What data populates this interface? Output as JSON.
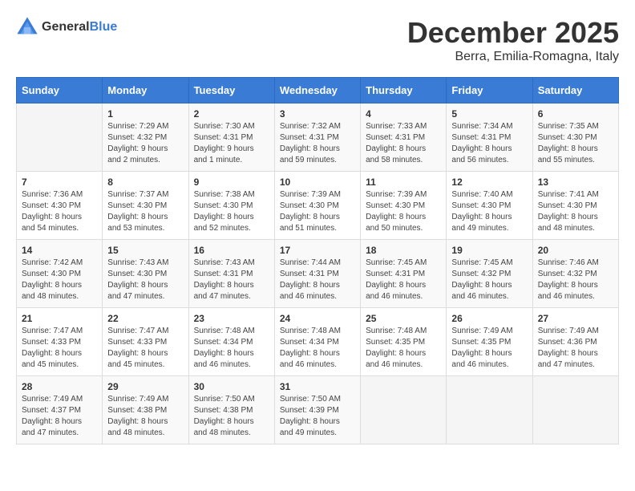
{
  "logo": {
    "text_general": "General",
    "text_blue": "Blue"
  },
  "title": "December 2025",
  "location": "Berra, Emilia-Romagna, Italy",
  "weekdays": [
    "Sunday",
    "Monday",
    "Tuesday",
    "Wednesday",
    "Thursday",
    "Friday",
    "Saturday"
  ],
  "rows": [
    [
      {
        "day": "",
        "lines": []
      },
      {
        "day": "1",
        "lines": [
          "Sunrise: 7:29 AM",
          "Sunset: 4:32 PM",
          "Daylight: 9 hours",
          "and 2 minutes."
        ]
      },
      {
        "day": "2",
        "lines": [
          "Sunrise: 7:30 AM",
          "Sunset: 4:31 PM",
          "Daylight: 9 hours",
          "and 1 minute."
        ]
      },
      {
        "day": "3",
        "lines": [
          "Sunrise: 7:32 AM",
          "Sunset: 4:31 PM",
          "Daylight: 8 hours",
          "and 59 minutes."
        ]
      },
      {
        "day": "4",
        "lines": [
          "Sunrise: 7:33 AM",
          "Sunset: 4:31 PM",
          "Daylight: 8 hours",
          "and 58 minutes."
        ]
      },
      {
        "day": "5",
        "lines": [
          "Sunrise: 7:34 AM",
          "Sunset: 4:31 PM",
          "Daylight: 8 hours",
          "and 56 minutes."
        ]
      },
      {
        "day": "6",
        "lines": [
          "Sunrise: 7:35 AM",
          "Sunset: 4:30 PM",
          "Daylight: 8 hours",
          "and 55 minutes."
        ]
      }
    ],
    [
      {
        "day": "7",
        "lines": [
          "Sunrise: 7:36 AM",
          "Sunset: 4:30 PM",
          "Daylight: 8 hours",
          "and 54 minutes."
        ]
      },
      {
        "day": "8",
        "lines": [
          "Sunrise: 7:37 AM",
          "Sunset: 4:30 PM",
          "Daylight: 8 hours",
          "and 53 minutes."
        ]
      },
      {
        "day": "9",
        "lines": [
          "Sunrise: 7:38 AM",
          "Sunset: 4:30 PM",
          "Daylight: 8 hours",
          "and 52 minutes."
        ]
      },
      {
        "day": "10",
        "lines": [
          "Sunrise: 7:39 AM",
          "Sunset: 4:30 PM",
          "Daylight: 8 hours",
          "and 51 minutes."
        ]
      },
      {
        "day": "11",
        "lines": [
          "Sunrise: 7:39 AM",
          "Sunset: 4:30 PM",
          "Daylight: 8 hours",
          "and 50 minutes."
        ]
      },
      {
        "day": "12",
        "lines": [
          "Sunrise: 7:40 AM",
          "Sunset: 4:30 PM",
          "Daylight: 8 hours",
          "and 49 minutes."
        ]
      },
      {
        "day": "13",
        "lines": [
          "Sunrise: 7:41 AM",
          "Sunset: 4:30 PM",
          "Daylight: 8 hours",
          "and 48 minutes."
        ]
      }
    ],
    [
      {
        "day": "14",
        "lines": [
          "Sunrise: 7:42 AM",
          "Sunset: 4:30 PM",
          "Daylight: 8 hours",
          "and 48 minutes."
        ]
      },
      {
        "day": "15",
        "lines": [
          "Sunrise: 7:43 AM",
          "Sunset: 4:30 PM",
          "Daylight: 8 hours",
          "and 47 minutes."
        ]
      },
      {
        "day": "16",
        "lines": [
          "Sunrise: 7:43 AM",
          "Sunset: 4:31 PM",
          "Daylight: 8 hours",
          "and 47 minutes."
        ]
      },
      {
        "day": "17",
        "lines": [
          "Sunrise: 7:44 AM",
          "Sunset: 4:31 PM",
          "Daylight: 8 hours",
          "and 46 minutes."
        ]
      },
      {
        "day": "18",
        "lines": [
          "Sunrise: 7:45 AM",
          "Sunset: 4:31 PM",
          "Daylight: 8 hours",
          "and 46 minutes."
        ]
      },
      {
        "day": "19",
        "lines": [
          "Sunrise: 7:45 AM",
          "Sunset: 4:32 PM",
          "Daylight: 8 hours",
          "and 46 minutes."
        ]
      },
      {
        "day": "20",
        "lines": [
          "Sunrise: 7:46 AM",
          "Sunset: 4:32 PM",
          "Daylight: 8 hours",
          "and 46 minutes."
        ]
      }
    ],
    [
      {
        "day": "21",
        "lines": [
          "Sunrise: 7:47 AM",
          "Sunset: 4:33 PM",
          "Daylight: 8 hours",
          "and 45 minutes."
        ]
      },
      {
        "day": "22",
        "lines": [
          "Sunrise: 7:47 AM",
          "Sunset: 4:33 PM",
          "Daylight: 8 hours",
          "and 45 minutes."
        ]
      },
      {
        "day": "23",
        "lines": [
          "Sunrise: 7:48 AM",
          "Sunset: 4:34 PM",
          "Daylight: 8 hours",
          "and 46 minutes."
        ]
      },
      {
        "day": "24",
        "lines": [
          "Sunrise: 7:48 AM",
          "Sunset: 4:34 PM",
          "Daylight: 8 hours",
          "and 46 minutes."
        ]
      },
      {
        "day": "25",
        "lines": [
          "Sunrise: 7:48 AM",
          "Sunset: 4:35 PM",
          "Daylight: 8 hours",
          "and 46 minutes."
        ]
      },
      {
        "day": "26",
        "lines": [
          "Sunrise: 7:49 AM",
          "Sunset: 4:35 PM",
          "Daylight: 8 hours",
          "and 46 minutes."
        ]
      },
      {
        "day": "27",
        "lines": [
          "Sunrise: 7:49 AM",
          "Sunset: 4:36 PM",
          "Daylight: 8 hours",
          "and 47 minutes."
        ]
      }
    ],
    [
      {
        "day": "28",
        "lines": [
          "Sunrise: 7:49 AM",
          "Sunset: 4:37 PM",
          "Daylight: 8 hours",
          "and 47 minutes."
        ]
      },
      {
        "day": "29",
        "lines": [
          "Sunrise: 7:49 AM",
          "Sunset: 4:38 PM",
          "Daylight: 8 hours",
          "and 48 minutes."
        ]
      },
      {
        "day": "30",
        "lines": [
          "Sunrise: 7:50 AM",
          "Sunset: 4:38 PM",
          "Daylight: 8 hours",
          "and 48 minutes."
        ]
      },
      {
        "day": "31",
        "lines": [
          "Sunrise: 7:50 AM",
          "Sunset: 4:39 PM",
          "Daylight: 8 hours",
          "and 49 minutes."
        ]
      },
      {
        "day": "",
        "lines": []
      },
      {
        "day": "",
        "lines": []
      },
      {
        "day": "",
        "lines": []
      }
    ]
  ]
}
